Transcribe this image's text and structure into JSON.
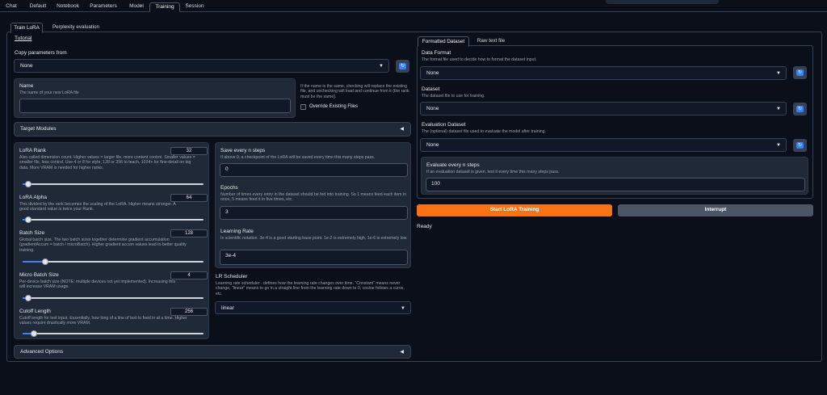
{
  "top_tabs": [
    "Chat",
    "Default",
    "Notebook",
    "Parameters",
    "Model",
    "Training",
    "Session"
  ],
  "sub_tabs": [
    "Train LoRA",
    "Perplexity evaluation"
  ],
  "tutorial_link": "Tutorial",
  "copy_params": {
    "label": "Copy parameters from",
    "value": "None"
  },
  "name": {
    "label": "Name",
    "info": "The name of your new LoRA file",
    "value": "",
    "side_note": "If the name is the same, checking will replace the existing file, and unchecking will load and continue from it (the rank must be the same).",
    "override_label": "Override Existing Files"
  },
  "target_modules": {
    "label": "Target Modules"
  },
  "lora_rank": {
    "label": "LoRA Rank",
    "value": "32",
    "info": "Also called dimension count. Higher values = larger file, more content control. Smaller values = smaller file, less control. Use 4 or 8 for style, 128 or 256 to teach, 1024+ for fine-detail on big data. More VRAM is needed for higher ranks.",
    "fraction": 0.03
  },
  "lora_alpha": {
    "label": "LoRA Alpha",
    "value": "64",
    "info": "This divided by the rank becomes the scaling of the LoRA. Higher means stronger. A good standard value is twice your Rank.",
    "fraction": 0.03
  },
  "batch_size": {
    "label": "Batch Size",
    "value": "128",
    "info": "Global batch size. The two batch sizes together determine gradient accumulation (gradientAccum = batch / microBatch). Higher gradient accum values lead to better quality training.",
    "fraction": 0.125
  },
  "micro_batch_size": {
    "label": "Micro Batch Size",
    "value": "4",
    "info": "Per-device batch size (NOTE: multiple devices not yet implemented). Increasing this will increase VRAM usage.",
    "fraction": 0.03
  },
  "cutoff_length": {
    "label": "Cutoff Length",
    "value": "256",
    "info": "Cutoff length for text input. Essentially, how long of a line of text to feed in at a time. Higher values require drastically more VRAM.",
    "fraction": 0.06
  },
  "save_steps": {
    "label": "Save every n steps",
    "info": "If above 0, a checkpoint of the LoRA will be saved every time this many steps pass.",
    "value": "0"
  },
  "epochs": {
    "label": "Epochs",
    "info": "Number of times every entry in the dataset should be fed into training. So 1 means feed each item in once, 5 means feed it in five times, etc.",
    "value": "3"
  },
  "learning_rate": {
    "label": "Learning Rate",
    "info": "In scientific notation. 3e-4 is a good starting base point. 1e-2 is extremely high, 1e-6 is extremely low.",
    "value": "3e-4"
  },
  "lr_scheduler": {
    "label": "LR Scheduler",
    "info": "Learning rate scheduler - defines how the learning rate changes over time. \"Constant\" means never change, \"linear\" means to go in a straight line from the learning rate down to 0, cosine follows a curve, etc.",
    "value": "linear"
  },
  "advanced_options": {
    "label": "Advanced Options"
  },
  "dataset_tabs": [
    "Formatted Dataset",
    "Raw text file"
  ],
  "data_format": {
    "label": "Data Format",
    "info": "The format file used to decide how to format the dataset input.",
    "value": "None"
  },
  "dataset": {
    "label": "Dataset",
    "info": "The dataset file to use for training.",
    "value": "None"
  },
  "eval_dataset": {
    "label": "Evaluation Dataset",
    "info": "The (optional) dataset file used to evaluate the model after training.",
    "value": "None"
  },
  "eval_steps": {
    "label": "Evaluate every n steps",
    "info": "If an evaluation dataset is given, test it every time this many steps pass.",
    "value": "100"
  },
  "buttons": {
    "start": "Start LoRA Training",
    "interrupt": "Interrupt"
  },
  "status": "Ready",
  "icons": {
    "refresh": "refresh-icon",
    "dropdown": "chevron-down-icon",
    "collapse": "triangle-left-icon"
  },
  "colors": {
    "accent": "#f97316",
    "slider": "#3b82f6",
    "background": "#0b0f19"
  }
}
